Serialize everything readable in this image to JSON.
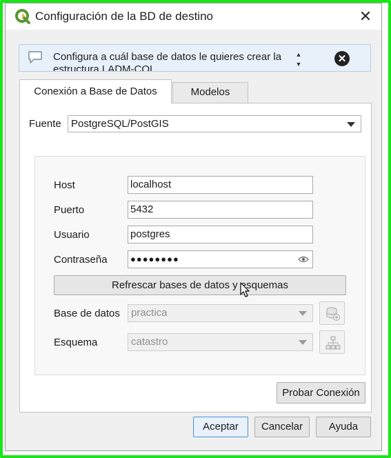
{
  "window": {
    "title": "Configuración de la BD de destino",
    "close_glyph": "✕"
  },
  "message_bar": {
    "text": "Configura a cuál base de datos le quieres crear la estructura LADM-COL",
    "icon": "speech-bubble-icon",
    "scroll_up": "▲",
    "scroll_down": "▼",
    "close_glyph": "✕"
  },
  "tabs": [
    {
      "label": "Conexión a Base de Datos",
      "active": true
    },
    {
      "label": "Modelos",
      "active": false
    }
  ],
  "source": {
    "label": "Fuente",
    "value": "PostgreSQL/PostGIS"
  },
  "connection": {
    "host_label": "Host",
    "host_value": "localhost",
    "port_label": "Puerto",
    "port_value": "5432",
    "user_label": "Usuario",
    "user_value": "postgres",
    "password_label": "Contraseña",
    "password_value": "●●●●●●●●"
  },
  "refresh_button": "Refrescar bases de datos y esquemas",
  "database": {
    "label": "Base de datos",
    "value": "practica"
  },
  "schema": {
    "label": "Esquema",
    "value": "catastro"
  },
  "test_button": "Probar Conexión",
  "footer": {
    "accept": "Aceptar",
    "cancel": "Cancelar",
    "help": "Ayuda"
  },
  "colors": {
    "frame_highlight": "#19e619",
    "message_bar_bg": "#e8f0f9",
    "default_button_border": "#4a90d9"
  }
}
